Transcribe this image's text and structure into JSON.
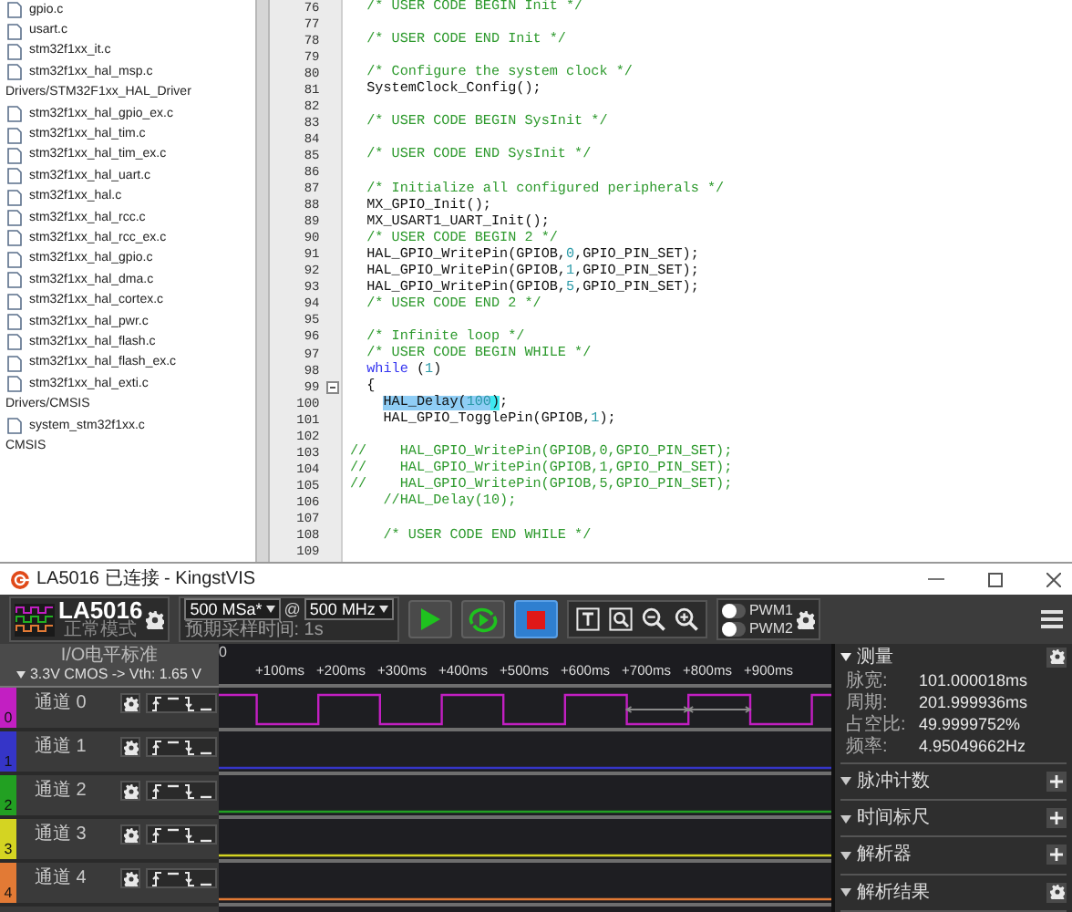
{
  "file_tree": [
    {
      "label": "gpio.c",
      "kind": "file"
    },
    {
      "label": "usart.c",
      "kind": "file"
    },
    {
      "label": "stm32f1xx_it.c",
      "kind": "file"
    },
    {
      "label": "stm32f1xx_hal_msp.c",
      "kind": "file"
    },
    {
      "label": "Drivers/STM32F1xx_HAL_Driver",
      "kind": "folder",
      "children": [
        {
          "label": "stm32f1xx_hal_gpio_ex.c",
          "kind": "file"
        },
        {
          "label": "stm32f1xx_hal_tim.c",
          "kind": "file"
        },
        {
          "label": "stm32f1xx_hal_tim_ex.c",
          "kind": "file"
        },
        {
          "label": "stm32f1xx_hal_uart.c",
          "kind": "file"
        },
        {
          "label": "stm32f1xx_hal.c",
          "kind": "file"
        },
        {
          "label": "stm32f1xx_hal_rcc.c",
          "kind": "file"
        },
        {
          "label": "stm32f1xx_hal_rcc_ex.c",
          "kind": "file"
        },
        {
          "label": "stm32f1xx_hal_gpio.c",
          "kind": "file"
        },
        {
          "label": "stm32f1xx_hal_dma.c",
          "kind": "file"
        },
        {
          "label": "stm32f1xx_hal_cortex.c",
          "kind": "file"
        },
        {
          "label": "stm32f1xx_hal_pwr.c",
          "kind": "file"
        },
        {
          "label": "stm32f1xx_hal_flash.c",
          "kind": "file"
        },
        {
          "label": "stm32f1xx_hal_flash_ex.c",
          "kind": "file"
        },
        {
          "label": "stm32f1xx_hal_exti.c",
          "kind": "file"
        }
      ]
    },
    {
      "label": "Drivers/CMSIS",
      "kind": "folder",
      "children": [
        {
          "label": "system_stm32f1xx.c",
          "kind": "file"
        }
      ]
    },
    {
      "label": "CMSIS",
      "kind": "folder"
    }
  ],
  "editor": {
    "lines": [
      {
        "number": "76",
        "segments": [
          {
            "kind": "comment",
            "text": "  /* USER CODE BEGIN Init */"
          }
        ]
      },
      {
        "number": "77"
      },
      {
        "number": "78",
        "segments": [
          {
            "kind": "comment",
            "text": "  /* USER CODE END Init */"
          }
        ]
      },
      {
        "number": "79"
      },
      {
        "number": "80",
        "segments": [
          {
            "kind": "comment",
            "text": "  /* Configure the system clock */"
          }
        ]
      },
      {
        "number": "81",
        "segments": [
          {
            "kind": "plain",
            "text": "  SystemClock_Config();"
          }
        ]
      },
      {
        "number": "82"
      },
      {
        "number": "83",
        "segments": [
          {
            "kind": "comment",
            "text": "  /* USER CODE BEGIN SysInit */"
          }
        ]
      },
      {
        "number": "84"
      },
      {
        "number": "85",
        "segments": [
          {
            "kind": "comment",
            "text": "  /* USER CODE END SysInit */"
          }
        ]
      },
      {
        "number": "86"
      },
      {
        "number": "87",
        "segments": [
          {
            "kind": "comment",
            "text": "  /* Initialize all configured peripherals */"
          }
        ]
      },
      {
        "number": "88",
        "segments": [
          {
            "kind": "plain",
            "text": "  MX_GPIO_Init();"
          }
        ]
      },
      {
        "number": "89",
        "segments": [
          {
            "kind": "plain",
            "text": "  MX_USART1_UART_Init();"
          }
        ]
      },
      {
        "number": "90",
        "segments": [
          {
            "kind": "comment",
            "text": "  /* USER CODE BEGIN 2 */"
          }
        ]
      },
      {
        "number": "91",
        "segments": [
          {
            "kind": "plain",
            "text": "  HAL_GPIO_WritePin(GPIOB,"
          },
          {
            "kind": "number",
            "text": "0"
          },
          {
            "kind": "plain",
            "text": ",GPIO_PIN_SET);"
          }
        ]
      },
      {
        "number": "92",
        "segments": [
          {
            "kind": "plain",
            "text": "  HAL_GPIO_WritePin(GPIOB,"
          },
          {
            "kind": "number",
            "text": "1"
          },
          {
            "kind": "plain",
            "text": ",GPIO_PIN_SET);"
          }
        ]
      },
      {
        "number": "93",
        "segments": [
          {
            "kind": "plain",
            "text": "  HAL_GPIO_WritePin(GPIOB,"
          },
          {
            "kind": "number",
            "text": "5"
          },
          {
            "kind": "plain",
            "text": ",GPIO_PIN_SET);"
          }
        ]
      },
      {
        "number": "94",
        "segments": [
          {
            "kind": "comment",
            "text": "  /* USER CODE END 2 */"
          }
        ]
      },
      {
        "number": "95"
      },
      {
        "number": "96",
        "segments": [
          {
            "kind": "comment",
            "text": "  /* Infinite loop */"
          }
        ]
      },
      {
        "number": "97",
        "segments": [
          {
            "kind": "comment",
            "text": "  /* USER CODE BEGIN WHILE */"
          }
        ]
      },
      {
        "number": "98",
        "segments": [
          {
            "kind": "keyword",
            "text": "  while"
          },
          {
            "kind": "plain",
            "text": " ("
          },
          {
            "kind": "number",
            "text": "1"
          },
          {
            "kind": "plain",
            "text": ")"
          }
        ]
      },
      {
        "number": "99",
        "fold": true,
        "segments": [
          {
            "kind": "plain",
            "text": "  {"
          }
        ]
      },
      {
        "number": "100",
        "segments": [
          {
            "kind": "highlight",
            "text": "    HAL_Delay("
          },
          {
            "kind": "highlight_number",
            "text": "100"
          },
          {
            "kind": "bracket",
            "text": ")"
          },
          {
            "kind": "plain",
            "text": ";"
          }
        ]
      },
      {
        "number": "101",
        "segments": [
          {
            "kind": "plain",
            "text": "    HAL_GPIO_TogglePin(GPIOB,"
          },
          {
            "kind": "number",
            "text": "1"
          },
          {
            "kind": "plain",
            "text": ");"
          }
        ]
      },
      {
        "number": "102"
      },
      {
        "number": "103",
        "segments": [
          {
            "kind": "comment",
            "text": "//    HAL_GPIO_WritePin(GPIOB,0,GPIO_PIN_SET);"
          }
        ]
      },
      {
        "number": "104",
        "segments": [
          {
            "kind": "comment",
            "text": "//    HAL_GPIO_WritePin(GPIOB,1,GPIO_PIN_SET);"
          }
        ]
      },
      {
        "number": "105",
        "segments": [
          {
            "kind": "comment",
            "text": "//    HAL_GPIO_WritePin(GPIOB,5,GPIO_PIN_SET);"
          }
        ]
      },
      {
        "number": "106",
        "segments": [
          {
            "kind": "comment",
            "text": "    //HAL_Delay(10);"
          }
        ]
      },
      {
        "number": "107"
      },
      {
        "number": "108",
        "segments": [
          {
            "kind": "comment",
            "text": "    /* USER CODE END WHILE */"
          }
        ]
      },
      {
        "number": "109"
      }
    ]
  },
  "analyzer": {
    "window": {
      "title": "LA5016 已连接 - KingstVIS"
    },
    "toolbar": {
      "device": "LA5016",
      "mode": "正常模式",
      "sample_rate": "500 MSa*",
      "at": "@",
      "sample_clock": "500 MHz",
      "expected_time": "预期采样时间: 1s",
      "run_buttons": [
        {
          "kind": "start",
          "selected": false
        },
        {
          "kind": "loop",
          "selected": false
        },
        {
          "kind": "stop",
          "selected": true
        }
      ],
      "view_tools": [
        {
          "kind": "text"
        },
        {
          "kind": "zoom_fit"
        },
        {
          "kind": "zoom_out"
        },
        {
          "kind": "zoom_in"
        }
      ],
      "pwm": [
        {
          "label": "PWM1",
          "on": false
        },
        {
          "label": "PWM2",
          "on": false
        }
      ]
    },
    "io_standard": {
      "title": "I/O电平标准",
      "value": "3.3V CMOS -> Vth: 1.65 V"
    },
    "timeline": {
      "origin": "0",
      "ticks": [
        "+100ms",
        "+200ms",
        "+300ms",
        "+400ms",
        "+500ms",
        "+600ms",
        "+700ms",
        "+800ms",
        "+900ms"
      ]
    },
    "channels": [
      {
        "number": "0",
        "name": "通道 0",
        "color": "#c21fc2",
        "kind": "pulse"
      },
      {
        "number": "1",
        "name": "通道 1",
        "color": "#3535c8",
        "kind": "low"
      },
      {
        "number": "2",
        "name": "通道 2",
        "color": "#22a022",
        "kind": "low"
      },
      {
        "number": "3",
        "name": "通道 3",
        "color": "#d4d422",
        "kind": "low"
      },
      {
        "number": "4",
        "name": "通道 4",
        "color": "#e27a35",
        "kind": "low"
      }
    ],
    "panel": {
      "measure": {
        "title": "测量",
        "expanded": true,
        "rows": [
          {
            "label": "脉宽:",
            "value": "101.000018ms"
          },
          {
            "label": "周期:",
            "value": "201.999936ms"
          },
          {
            "label": "占空比:",
            "value": "49.9999752%"
          },
          {
            "label": "频率:",
            "value": "4.95049662Hz"
          }
        ]
      },
      "sections": [
        {
          "title": "脉冲计数",
          "expanded": false,
          "kind": "add"
        },
        {
          "title": "时间标尺",
          "expanded": false,
          "kind": "add"
        },
        {
          "title": "解析器",
          "expanded": false,
          "kind": "add"
        },
        {
          "title": "解析结果",
          "expanded": false,
          "kind": "settings"
        }
      ]
    }
  }
}
